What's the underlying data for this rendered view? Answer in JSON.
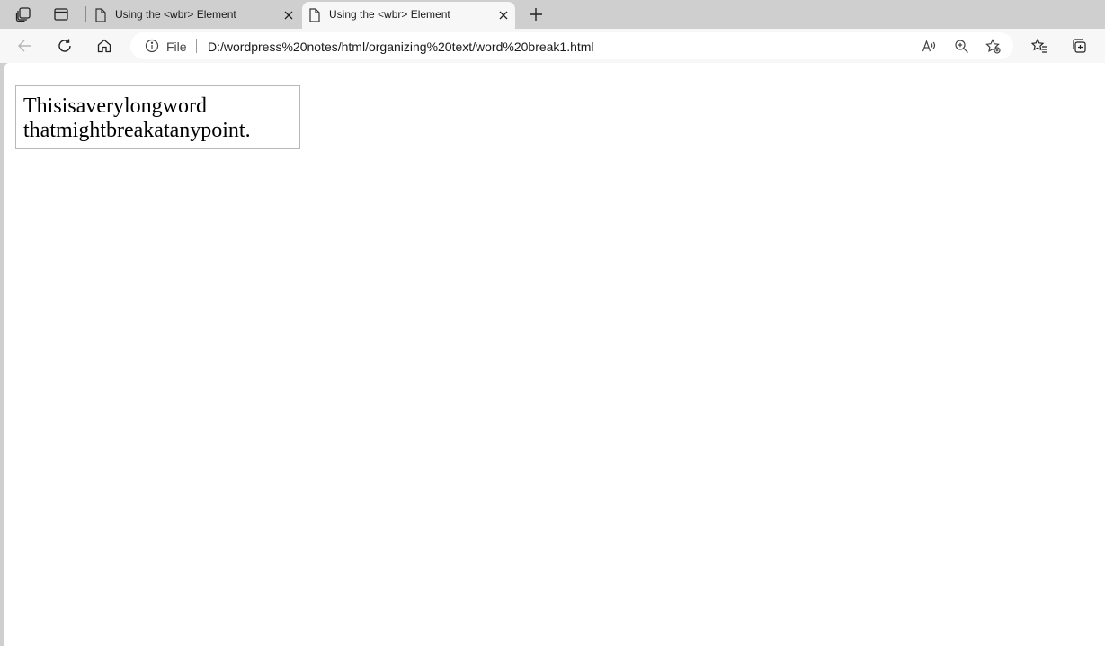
{
  "tabs": [
    {
      "title": "Using the <wbr> Element",
      "active": false
    },
    {
      "title": "Using the <wbr> Element",
      "active": true
    }
  ],
  "address_bar": {
    "scheme_label": "File",
    "url": "D:/wordpress%20notes/html/organizing%20text/word%20break1.html"
  },
  "icons": {
    "workspaces": "workspaces-icon",
    "vertical_tabs": "tab-actions-icon",
    "doc": "document-icon",
    "close": "close-icon",
    "new_tab": "plus-icon",
    "back": "back-arrow-icon",
    "refresh": "refresh-icon",
    "home": "home-icon",
    "info": "info-icon",
    "read_aloud": "read-aloud-icon",
    "zoom": "zoom-icon",
    "add_favorite": "add-favorite-icon",
    "favorites": "favorites-icon",
    "collections": "collections-icon"
  },
  "page": {
    "line1": "Thisisaverylongword",
    "line2": "thatmightbreakatanypoint."
  },
  "colors": {
    "tabstrip": "#cfcfcf",
    "toolbar": "#f7f7f7",
    "box_border": "#b8b8b8"
  }
}
